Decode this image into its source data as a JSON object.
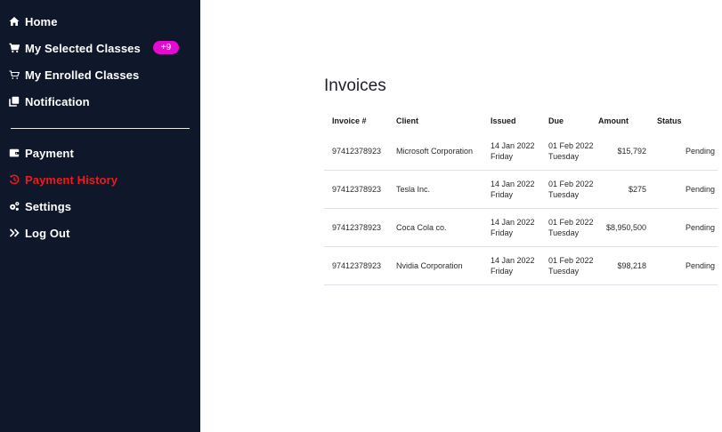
{
  "sidebar": {
    "items_top": [
      {
        "label": "Home",
        "icon": "home-icon"
      },
      {
        "label": "My Selected Classes",
        "icon": "cart-icon",
        "badge": "+9"
      },
      {
        "label": "My Enrolled Classes",
        "icon": "cart-outline-icon"
      },
      {
        "label": "Notification",
        "icon": "copy-icon"
      }
    ],
    "items_bottom": [
      {
        "label": "Payment",
        "icon": "wallet-icon"
      },
      {
        "label": "Payment History",
        "icon": "history-icon",
        "active": true
      },
      {
        "label": "Settings",
        "icon": "gears-icon"
      },
      {
        "label": "Log Out",
        "icon": "double-chevron-right-icon"
      }
    ],
    "colors": {
      "background": "#0f172a",
      "active": "#ef1a1a",
      "badge": "#e40bd1"
    }
  },
  "main": {
    "title": "Invoices",
    "table": {
      "headers": [
        "Invoice #",
        "Client",
        "Issued",
        "Due",
        "Amount",
        "Status"
      ],
      "rows": [
        {
          "invoice": "97412378923",
          "client": "Microsoft Corporation",
          "issued_date": "14 Jan 2022",
          "issued_day": "Friday",
          "due_date": "01 Feb 2022",
          "due_day": "Tuesday",
          "amount": "$15,792",
          "status": "Pending"
        },
        {
          "invoice": "97412378923",
          "client": "Tesla Inc.",
          "issued_date": "14 Jan 2022",
          "issued_day": "Friday",
          "due_date": "01 Feb 2022",
          "due_day": "Tuesday",
          "amount": "$275",
          "status": "Pending"
        },
        {
          "invoice": "97412378923",
          "client": "Coca Cola co.",
          "issued_date": "14 Jan 2022",
          "issued_day": "Friday",
          "due_date": "01 Feb 2022",
          "due_day": "Tuesday",
          "amount": "$8,950,500",
          "status": "Pending"
        },
        {
          "invoice": "97412378923",
          "client": "Nvidia Corporation",
          "issued_date": "14 Jan 2022",
          "issued_day": "Friday",
          "due_date": "01 Feb 2022",
          "due_day": "Tuesday",
          "amount": "$98,218",
          "status": "Pending"
        }
      ]
    }
  }
}
